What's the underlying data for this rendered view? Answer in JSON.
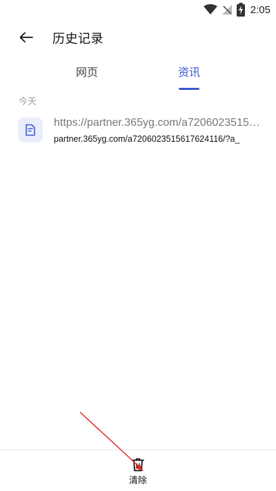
{
  "status_bar": {
    "time": "2:05",
    "icons": [
      "wifi-icon",
      "no-signal-icon",
      "battery-charging-icon"
    ]
  },
  "header": {
    "title": "历史记录",
    "back_icon": "arrow-left-icon"
  },
  "tabs": [
    {
      "label": "网页",
      "active": false
    },
    {
      "label": "资讯",
      "active": true
    }
  ],
  "section": {
    "label": "今天"
  },
  "items": [
    {
      "icon": "document-icon",
      "title": "https://partner.365yg.com/a7206023515…",
      "url": "partner.365yg.com/a7206023515617624116/?a_"
    }
  ],
  "bottom_bar": {
    "clear_label": "清除",
    "clear_icon": "trash-icon"
  },
  "colors": {
    "accent": "#3a57d6",
    "icon_bg": "#eaedfa",
    "muted_text": "#a0a0a0",
    "annotation": "#e02020"
  }
}
